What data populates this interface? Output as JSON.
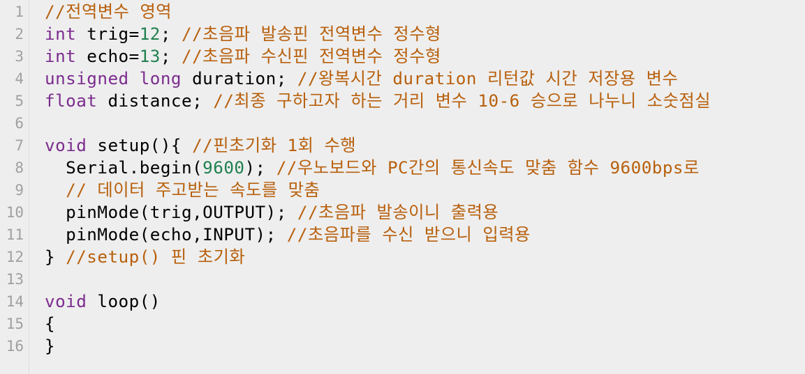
{
  "editor": {
    "colors": {
      "background": "#eeeeee",
      "keyword": "#7b2c8e",
      "number": "#20804f",
      "comment": "#b8600d",
      "text": "#000000",
      "line_number": "#a0a0a0"
    },
    "lines": [
      {
        "num": "1",
        "tokens": [
          {
            "t": "cm",
            "v": "//전역변수 영역"
          }
        ]
      },
      {
        "num": "2",
        "tokens": [
          {
            "t": "kw",
            "v": "int"
          },
          {
            "t": "pl",
            "v": " trig="
          },
          {
            "t": "num",
            "v": "12"
          },
          {
            "t": "pl",
            "v": "; "
          },
          {
            "t": "cm",
            "v": "//초음파 발송핀 전역변수 정수형"
          }
        ]
      },
      {
        "num": "3",
        "tokens": [
          {
            "t": "kw",
            "v": "int"
          },
          {
            "t": "pl",
            "v": " echo="
          },
          {
            "t": "num",
            "v": "13"
          },
          {
            "t": "pl",
            "v": "; "
          },
          {
            "t": "cm",
            "v": "//초음파 수신핀 전역변수 정수형"
          }
        ]
      },
      {
        "num": "4",
        "tokens": [
          {
            "t": "kw",
            "v": "unsigned"
          },
          {
            "t": "pl",
            "v": " "
          },
          {
            "t": "kw",
            "v": "long"
          },
          {
            "t": "pl",
            "v": " duration; "
          },
          {
            "t": "cm",
            "v": "//왕복시간 duration 리턴값 시간 저장용 변수"
          }
        ]
      },
      {
        "num": "5",
        "tokens": [
          {
            "t": "kw",
            "v": "float"
          },
          {
            "t": "pl",
            "v": " distance; "
          },
          {
            "t": "cm",
            "v": "//최종 구하고자 하는 거리 변수 10-6 승으로 나누니 소숫점실"
          }
        ]
      },
      {
        "num": "6",
        "tokens": []
      },
      {
        "num": "7",
        "tokens": [
          {
            "t": "kw",
            "v": "void"
          },
          {
            "t": "pl",
            "v": " setup(){ "
          },
          {
            "t": "cm",
            "v": "//핀초기화 1회 수행"
          }
        ]
      },
      {
        "num": "8",
        "tokens": [
          {
            "t": "pl",
            "v": "  Serial.begin("
          },
          {
            "t": "num",
            "v": "9600"
          },
          {
            "t": "pl",
            "v": "); "
          },
          {
            "t": "cm",
            "v": "//우노보드와 PC간의 통신속도 맞춤 함수 9600bps로"
          }
        ]
      },
      {
        "num": "9",
        "tokens": [
          {
            "t": "cm",
            "v": "  // 데이터 주고받는 속도를 맞춤"
          }
        ]
      },
      {
        "num": "10",
        "tokens": [
          {
            "t": "pl",
            "v": "  pinMode(trig,OUTPUT); "
          },
          {
            "t": "cm",
            "v": "//초음파 발송이니 출력용"
          }
        ]
      },
      {
        "num": "11",
        "tokens": [
          {
            "t": "pl",
            "v": "  pinMode(echo,INPUT); "
          },
          {
            "t": "cm",
            "v": "//초음파를 수신 받으니 입력용"
          }
        ]
      },
      {
        "num": "12",
        "tokens": [
          {
            "t": "pl",
            "v": "} "
          },
          {
            "t": "cm",
            "v": "//setup() 핀 초기화"
          }
        ]
      },
      {
        "num": "13",
        "tokens": []
      },
      {
        "num": "14",
        "tokens": [
          {
            "t": "kw",
            "v": "void"
          },
          {
            "t": "pl",
            "v": " loop()"
          }
        ]
      },
      {
        "num": "15",
        "tokens": [
          {
            "t": "pl",
            "v": "{"
          }
        ]
      },
      {
        "num": "16",
        "tokens": [
          {
            "t": "pl",
            "v": "}"
          }
        ]
      }
    ]
  }
}
